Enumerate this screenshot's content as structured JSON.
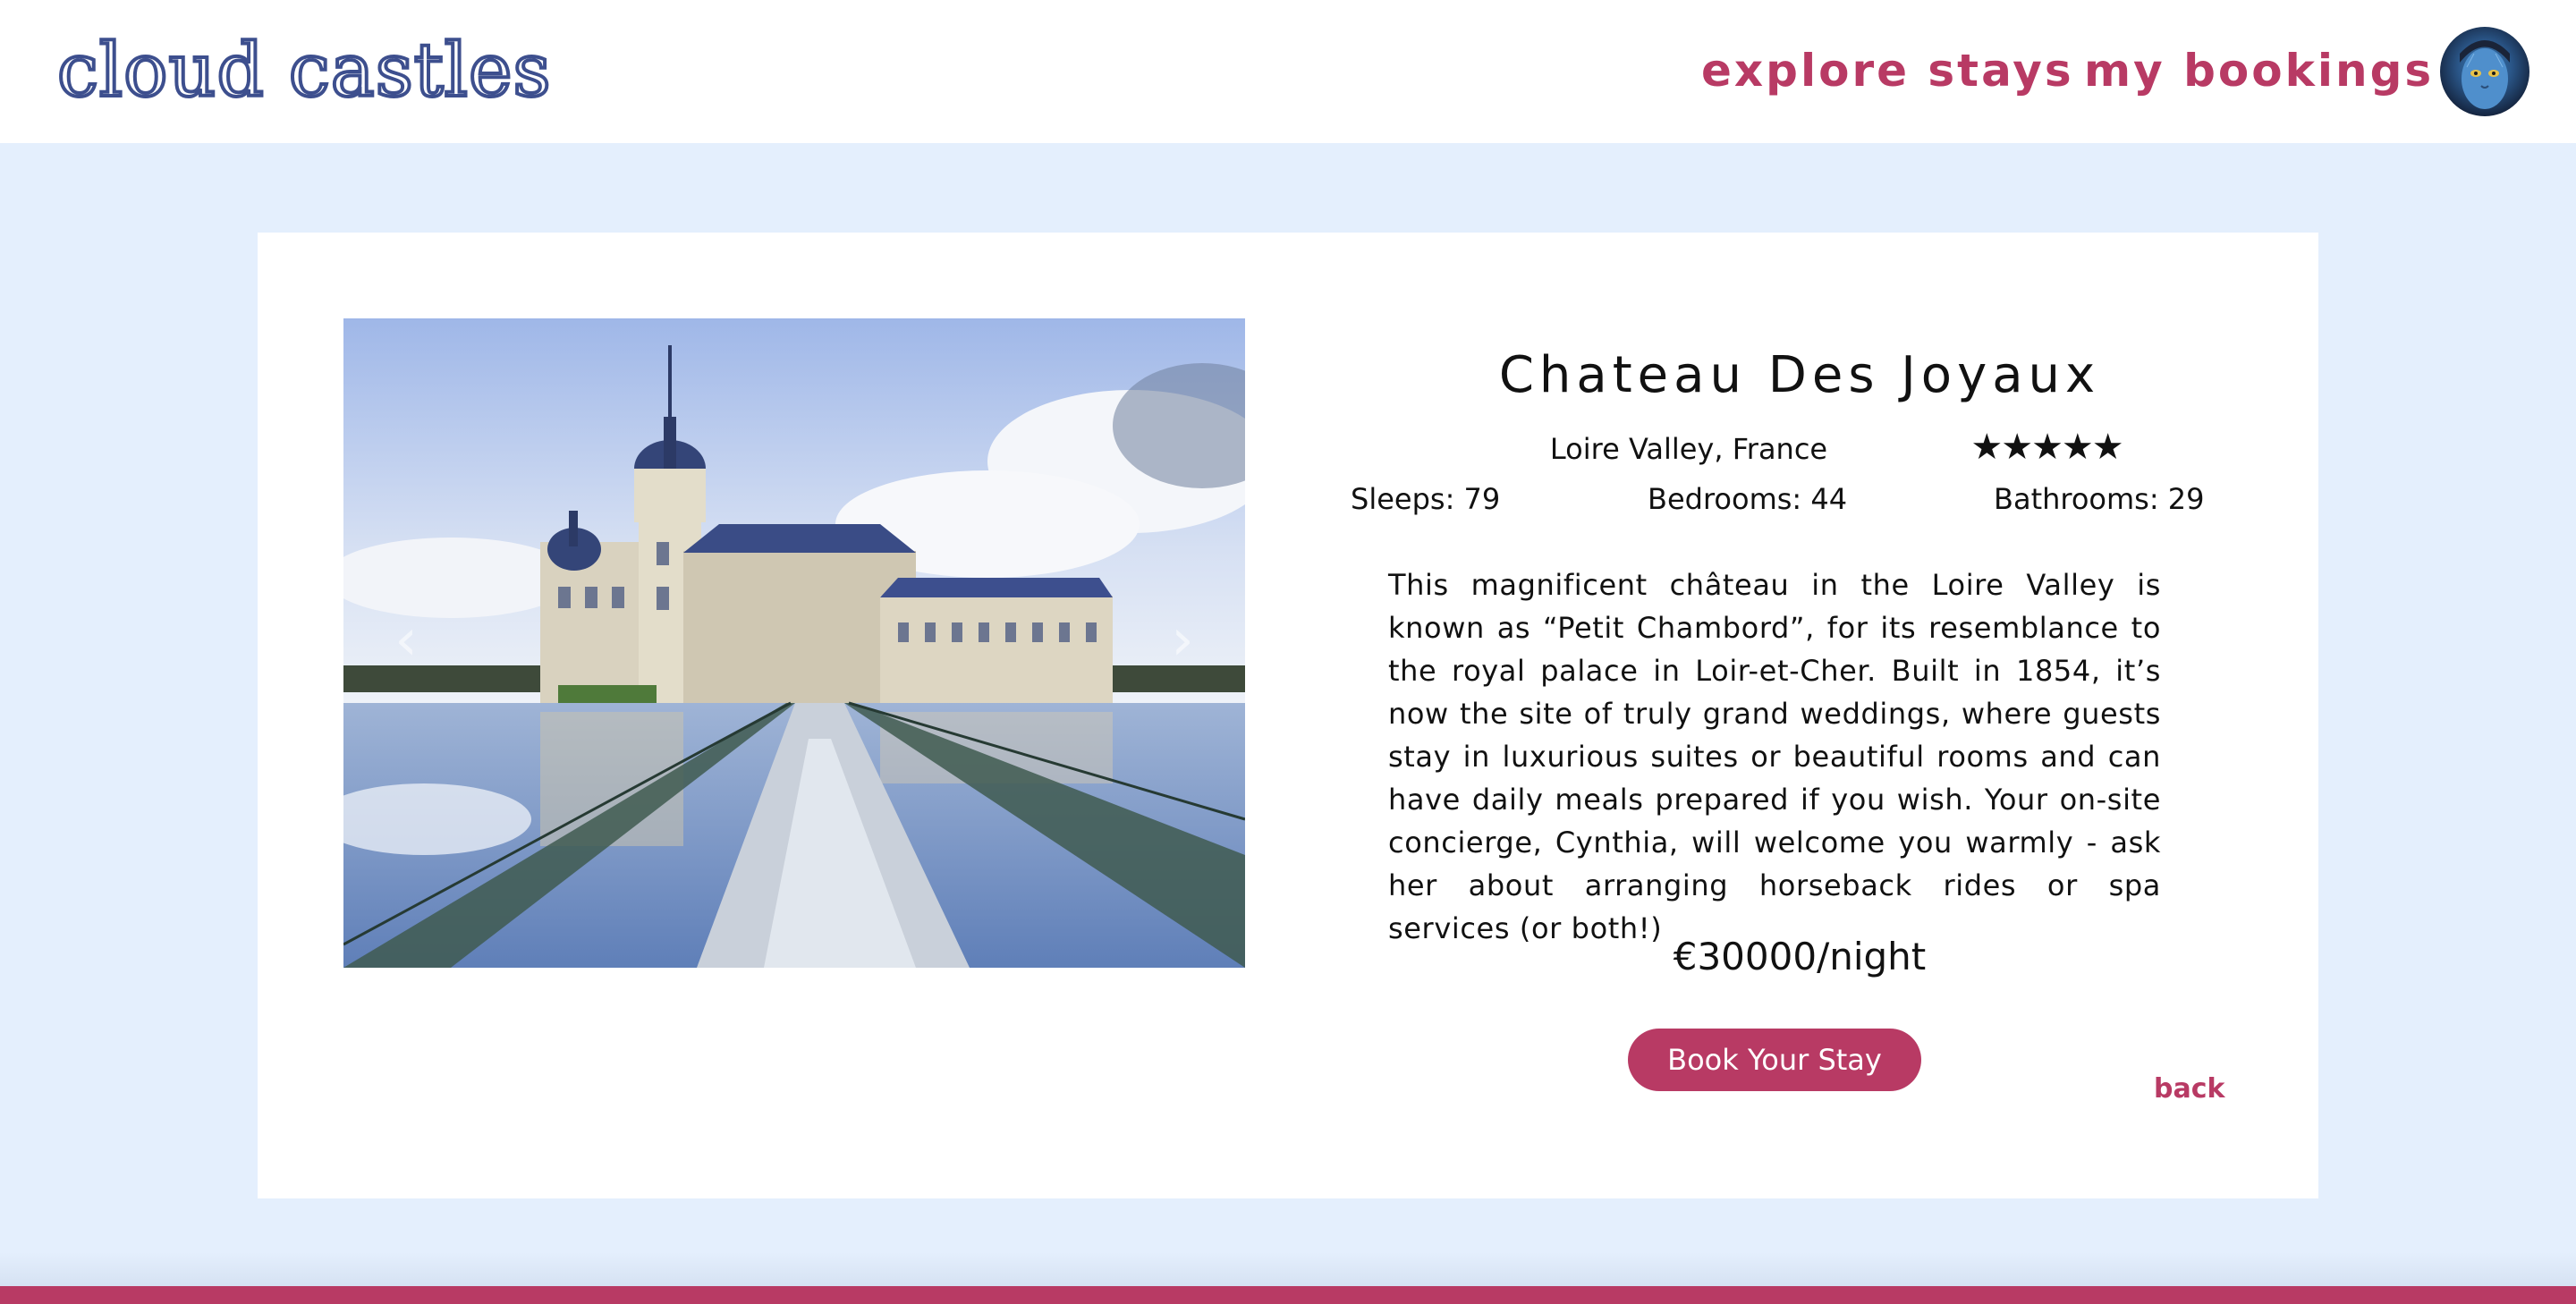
{
  "header": {
    "logo": "cloud castles",
    "nav": {
      "explore": "explore stays",
      "bookings": "my bookings"
    },
    "avatar_alt": "user avatar"
  },
  "listing": {
    "title": "Chateau Des Joyaux",
    "location": "Loire Valley, France",
    "rating_stars": "★★★★★",
    "rating": 5,
    "sleeps": "Sleeps: 79",
    "bedrooms": "Bedrooms: 44",
    "bathrooms": "Bathrooms: 29",
    "description": "This magnificent château in the Loire Valley is known as “Petit Chambord”, for its resemblance to the royal palace in Loir-et-Cher. Built in 1854, it’s now the site of truly grand weddings, where guests stay in luxurious suites or beautiful rooms and can have daily meals prepared if you wish. Your on-site concierge, Cynthia, will welcome you warmly - ask her about arranging horseback rides or spa services (or both!)",
    "price": "€30000/night",
    "book_label": "Book Your Stay",
    "back_label": "back",
    "carousel": {
      "prev": "‹",
      "next": "›"
    }
  },
  "colors": {
    "brand_pink": "#b83a64",
    "logo_blue": "#3d4f8e",
    "page_background": "#e4effd",
    "card_background": "#ffffff"
  },
  "icons": {
    "avatar": "user-avatar-icon",
    "prev": "chevron-left-icon",
    "next": "chevron-right-icon"
  }
}
